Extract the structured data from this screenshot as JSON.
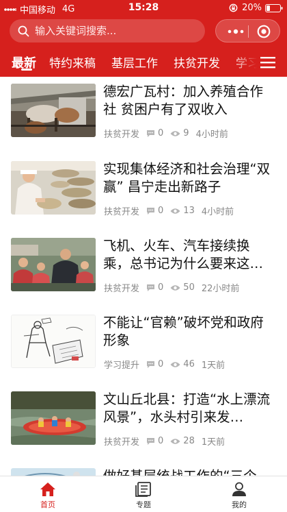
{
  "status_bar": {
    "carrier": "中国移动",
    "network": "4G",
    "time": "15:28",
    "battery": "20%"
  },
  "search": {
    "placeholder": "输入关键词搜索..."
  },
  "tabs": [
    {
      "label": "最新",
      "active": true
    },
    {
      "label": "特约来稿"
    },
    {
      "label": "基层工作"
    },
    {
      "label": "扶贫开发"
    },
    {
      "label": "学习"
    }
  ],
  "articles": [
    {
      "title": "德宏广瓦村：加入养殖合作社 贫困户有了双收入",
      "category": "扶贫开发",
      "comments": "0",
      "views": "9",
      "time": "4小时前"
    },
    {
      "title": "实现集体经济和社会治理“双赢” 昌宁走出新路子",
      "category": "扶贫开发",
      "comments": "0",
      "views": "13",
      "time": "4小时前"
    },
    {
      "title": "飞机、火车、汽车接续换乘，总书记为什么要来这…",
      "category": "扶贫开发",
      "comments": "0",
      "views": "50",
      "time": "22小时前"
    },
    {
      "title": "不能让“官赖”破坏党和政府形象",
      "category": "学习提升",
      "comments": "0",
      "views": "46",
      "time": "1天前"
    },
    {
      "title": "文山丘北县：打造“水上漂流风景”，水头村引来发…",
      "category": "扶贫开发",
      "comments": "0",
      "views": "28",
      "time": "1天前"
    },
    {
      "title": "做好基层统战工作的“三个",
      "category": "",
      "comments": "",
      "views": "",
      "time": ""
    }
  ],
  "bottom_nav": [
    {
      "label": "首页",
      "icon": "home-icon",
      "active": true
    },
    {
      "label": "专题",
      "icon": "topic-icon"
    },
    {
      "label": "我的",
      "icon": "user-icon"
    }
  ],
  "colors": {
    "brand_red": "#d6201d",
    "text_gray": "#888888"
  }
}
